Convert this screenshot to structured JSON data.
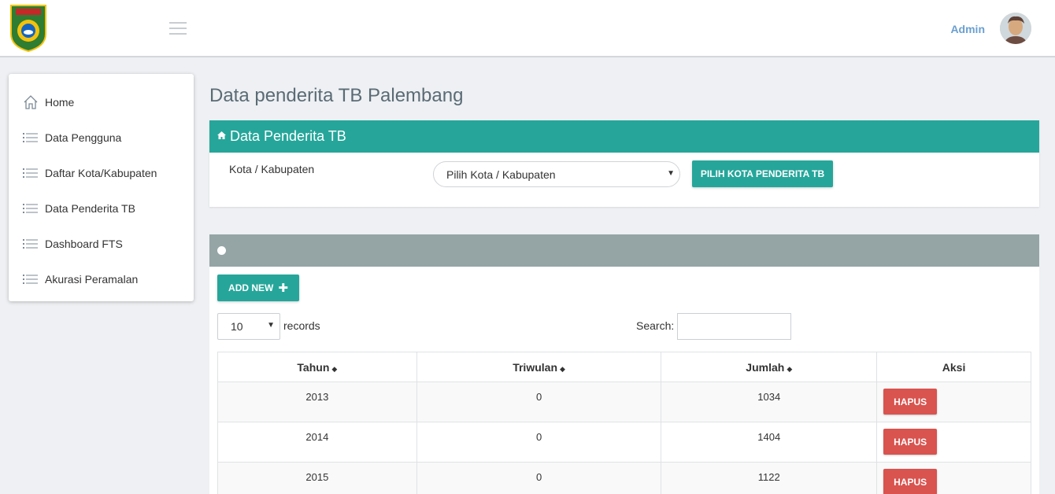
{
  "header": {
    "admin_name": "Admin",
    "menu_icon": "hamburger-icon"
  },
  "sidebar": {
    "items": [
      {
        "label": "Home",
        "icon": "home-icon"
      },
      {
        "label": "Data Pengguna",
        "icon": "list-icon"
      },
      {
        "label": "Daftar Kota/Kabupaten",
        "icon": "list-icon"
      },
      {
        "label": "Data Penderita TB",
        "icon": "list-icon"
      },
      {
        "label": "Dashboard FTS",
        "icon": "list-icon"
      },
      {
        "label": "Akurasi Peramalan",
        "icon": "list-icon"
      }
    ]
  },
  "main": {
    "page_title": "Data penderita TB Palembang",
    "filter_panel": {
      "title": "Data Penderita TB",
      "kota_label": "Kota / Kabupaten",
      "select_value": "Pilih Kota / Kabupaten",
      "button_label": "PILIH KOTA PENDERITA TB"
    },
    "table_panel": {
      "add_button": "ADD NEW",
      "page_length": "10",
      "records_label": "records",
      "search_label": "Search:",
      "search_value": "",
      "columns": [
        "Tahun",
        "Triwulan",
        "Jumlah",
        "Aksi"
      ],
      "rows": [
        {
          "tahun": "2013",
          "triwulan": "0",
          "jumlah": "1034",
          "aksi": "HAPUS"
        },
        {
          "tahun": "2014",
          "triwulan": "0",
          "jumlah": "1404",
          "aksi": "HAPUS"
        },
        {
          "tahun": "2015",
          "triwulan": "0",
          "jumlah": "1122",
          "aksi": "HAPUS"
        }
      ]
    }
  },
  "colors": {
    "primary": "#26a69a",
    "panel_header_grey": "#95a5a6",
    "danger": "#d9534f",
    "admin_text": "#6a9fd0"
  }
}
